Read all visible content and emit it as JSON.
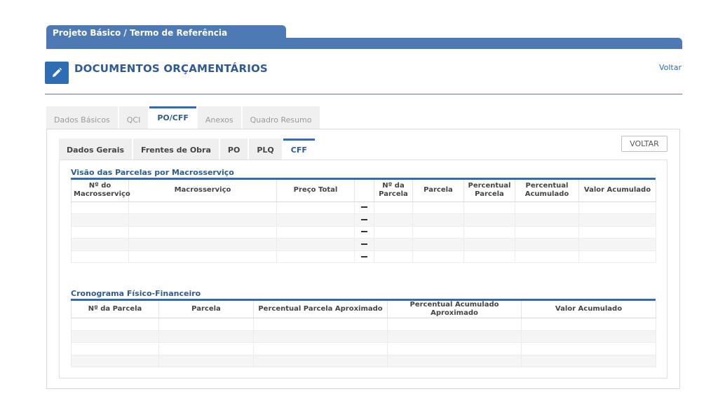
{
  "header": {
    "breadcrumb": "Projeto Básico / Termo de Referência",
    "title": "DOCUMENTOS ORÇAMENTÁRIOS",
    "back_link": "Voltar",
    "icon": "pencil-icon",
    "accent_color": "#2e6db4"
  },
  "outer_tabs": [
    {
      "label": "Dados Básicos",
      "active": false
    },
    {
      "label": "QCI",
      "active": false
    },
    {
      "label": "PO/CFF",
      "active": true
    },
    {
      "label": "Anexos",
      "active": false
    },
    {
      "label": "Quadro Resumo",
      "active": false
    }
  ],
  "inner_tabs": [
    {
      "label": "Dados Gerais",
      "active": false
    },
    {
      "label": "Frentes de Obra",
      "active": false
    },
    {
      "label": "PO",
      "active": false
    },
    {
      "label": "PLQ",
      "active": false
    },
    {
      "label": "CFF",
      "active": true
    }
  ],
  "voltar_button": "VOLTAR",
  "visao": {
    "title": "Visão das Parcelas por Macrosserviço",
    "columns": [
      "Nº do Macrosserviço",
      "Macrosserviço",
      "Preço Total",
      "",
      "Nº da Parcela",
      "Parcela",
      "Percentual Parcela",
      "Percentual Acumulado",
      "Valor Acumulado"
    ],
    "row_count": 5
  },
  "cronograma": {
    "title": "Cronograma Físico-Financeiro",
    "columns": [
      "Nº da Parcela",
      "Parcela",
      "Percentual Parcela Aproximado",
      "Percentual Acumulado Aproximado",
      "Valor Acumulado"
    ],
    "row_count": 4
  }
}
